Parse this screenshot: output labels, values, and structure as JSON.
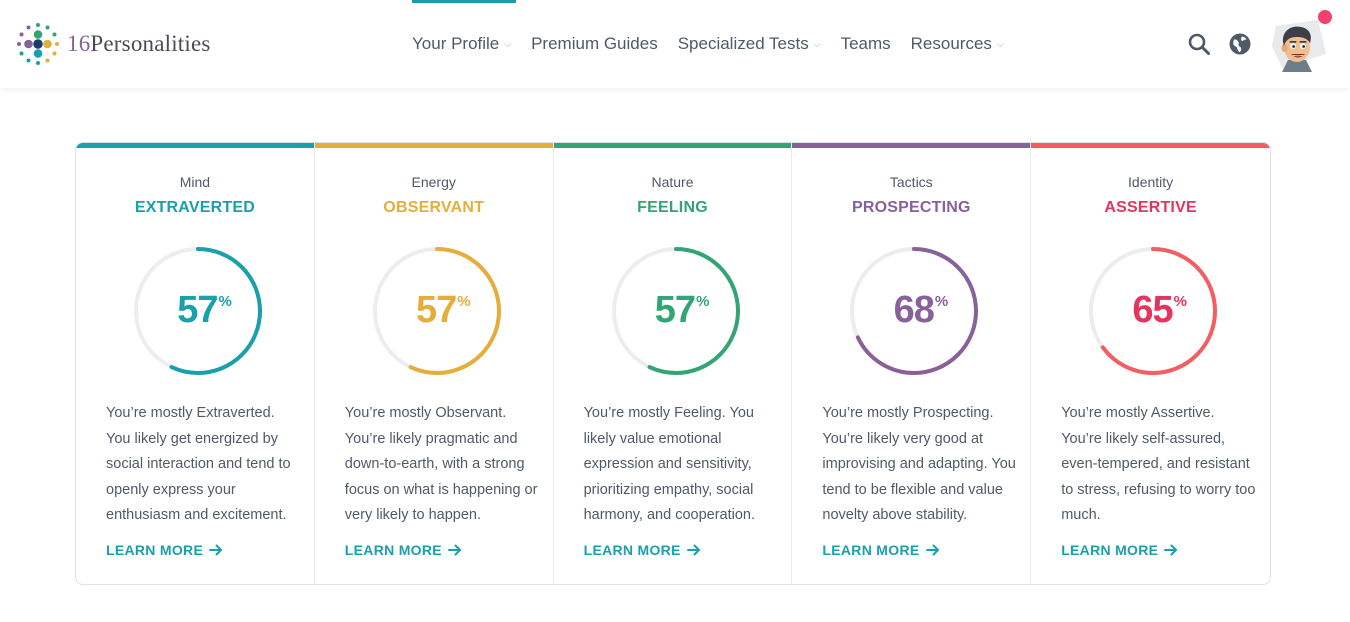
{
  "brand": {
    "number": "16",
    "name": "Personalities"
  },
  "nav": [
    {
      "label": "Your Profile",
      "has_dropdown": true,
      "active": true
    },
    {
      "label": "Premium Guides",
      "has_dropdown": false,
      "active": false
    },
    {
      "label": "Specialized Tests",
      "has_dropdown": true,
      "active": false
    },
    {
      "label": "Teams",
      "has_dropdown": false,
      "active": false
    },
    {
      "label": "Resources",
      "has_dropdown": true,
      "active": false
    }
  ],
  "header_icons": [
    "search-icon",
    "globe-icon",
    "user-avatar"
  ],
  "colors": {
    "mind": "#1a9fac",
    "energy": "#e4ae3a",
    "nature": "#33a474",
    "tactics": "#88619a",
    "identity": "#f25e62",
    "identity_text": "#e5345d",
    "notification": "#f1416c",
    "track": "#ebedef"
  },
  "traits": [
    {
      "category": "Mind",
      "type": "EXTRAVERTED",
      "value": "57",
      "percent_sign": "%",
      "level": 0.57,
      "description": "You’re mostly Extraverted. You likely get energized by social interaction and tend to openly express your enthusiasm and excitement.",
      "link": "LEARN MORE"
    },
    {
      "category": "Energy",
      "type": "OBSERVANT",
      "value": "57",
      "percent_sign": "%",
      "level": 0.57,
      "description": "You’re mostly Observant. You’re likely pragmatic and down-to-earth, with a strong focus on what is happening or very likely to happen.",
      "link": "LEARN MORE"
    },
    {
      "category": "Nature",
      "type": "FEELING",
      "value": "57",
      "percent_sign": "%",
      "level": 0.57,
      "description": "You’re mostly Feeling. You likely value emotional expression and sensitivity, prioritizing empathy, social harmony, and cooperation.",
      "link": "LEARN MORE"
    },
    {
      "category": "Tactics",
      "type": "PROSPECTING",
      "value": "68",
      "percent_sign": "%",
      "level": 0.68,
      "description": "You’re mostly Prospecting. You’re likely very good at improvising and adapting. You tend to be flexible and value novelty above stability.",
      "link": "LEARN MORE"
    },
    {
      "category": "Identity",
      "type": "ASSERTIVE",
      "value": "65",
      "percent_sign": "%",
      "level": 0.65,
      "description": "You’re mostly Assertive. You’re likely self-assured, even-tempered, and resistant to stress, refusing to worry too much.",
      "link": "LEARN MORE"
    }
  ]
}
